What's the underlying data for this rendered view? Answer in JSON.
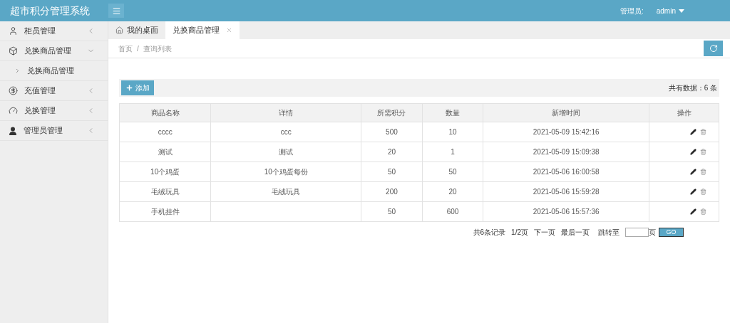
{
  "header": {
    "title": "超市积分管理系统",
    "user_label": "管理员:",
    "user_name": "admin"
  },
  "sidebar": {
    "items": [
      {
        "label": "柜员管理",
        "expanded": false
      },
      {
        "label": "兑换商品管理",
        "expanded": true,
        "children": [
          {
            "label": "兑换商品管理"
          }
        ]
      },
      {
        "label": "充值管理",
        "expanded": false
      },
      {
        "label": "兑换管理",
        "expanded": false
      },
      {
        "label": "管理员管理",
        "expanded": false
      }
    ]
  },
  "tabs": [
    {
      "label": "我的桌面",
      "kind": "home",
      "selected": false
    },
    {
      "label": "兑换商品管理",
      "kind": "closable",
      "selected": true
    }
  ],
  "breadcrumb": [
    "首页",
    "/",
    "查询列表"
  ],
  "toolbar": {
    "add_button": "添加",
    "total": "共有数据：6 条"
  },
  "table": {
    "columns": [
      "商品名称",
      "详情",
      "所需积分",
      "数量",
      "新增时间",
      "操作"
    ],
    "rows": [
      [
        "cccc",
        "ccc",
        "500",
        "10",
        "2021-05-09 15:42:16"
      ],
      [
        "测试",
        "测试",
        "20",
        "1",
        "2021-05-09 15:09:38"
      ],
      [
        "10个鸡蛋",
        "10个鸡蛋每份",
        "50",
        "50",
        "2021-05-06 16:00:58"
      ],
      [
        "毛绒玩具",
        "毛绒玩具",
        "200",
        "20",
        "2021-05-06 15:59:28"
      ],
      [
        "手机挂件",
        "",
        "50",
        "600",
        "2021-05-06 15:57:36"
      ]
    ]
  },
  "pagination": {
    "records": "共6条记录",
    "pages": "1/2页",
    "next": "下一页",
    "last": "最后一页",
    "jump_label": "跳转至",
    "page_unit": "页",
    "go": "GO"
  }
}
